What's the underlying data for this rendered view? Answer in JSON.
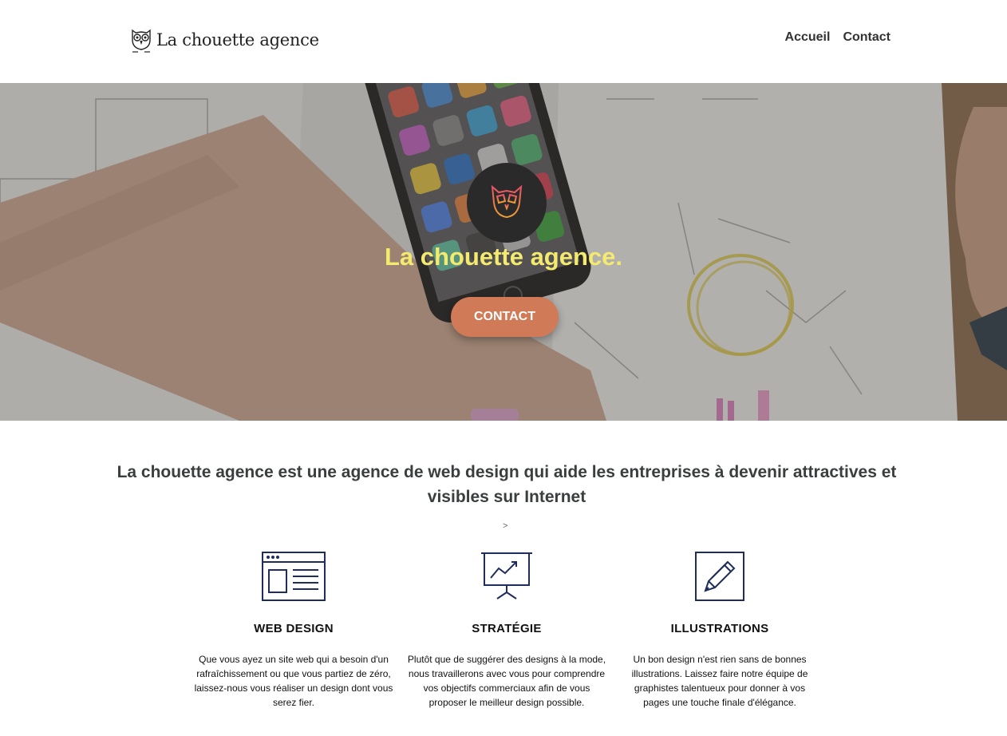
{
  "header": {
    "logo_text": "La chouette agence",
    "nav": [
      {
        "label": "Accueil"
      },
      {
        "label": "Contact"
      }
    ]
  },
  "hero": {
    "title": "La chouette agence.",
    "cta_label": "CONTACT"
  },
  "intro": {
    "text": "La chouette agence est une agence de web design qui aide les entreprises à devenir attractives et visibles sur Internet",
    "arrow": ">"
  },
  "features": [
    {
      "icon": "web-design-icon",
      "title": "WEB DESIGN",
      "text": "Que vous ayez un site web qui a besoin d'un rafraîchissement ou que vous partiez de zéro, laissez-nous vous réaliser un design dont vous serez fier."
    },
    {
      "icon": "presentation-chart-icon",
      "title": "STRATÉGIE",
      "text": "Plutôt que de suggérer des designs à la mode, nous travaillerons avec vous pour comprendre vos objectifs commerciaux afin de vous proposer le meilleur design possible."
    },
    {
      "icon": "pencil-icon",
      "title": "ILLUSTRATIONS",
      "text": "Un bon design n'est rien sans de bonnes illustrations. Laissez faire notre équipe de graphistes talentueux pour donner à vos pages une touche finale d'élégance."
    }
  ],
  "colors": {
    "hero_title": "#f3ea6f",
    "cta_bg": "#d07a58",
    "icon_navy": "#1f2d5c",
    "owl_orange": "#e3783a"
  }
}
